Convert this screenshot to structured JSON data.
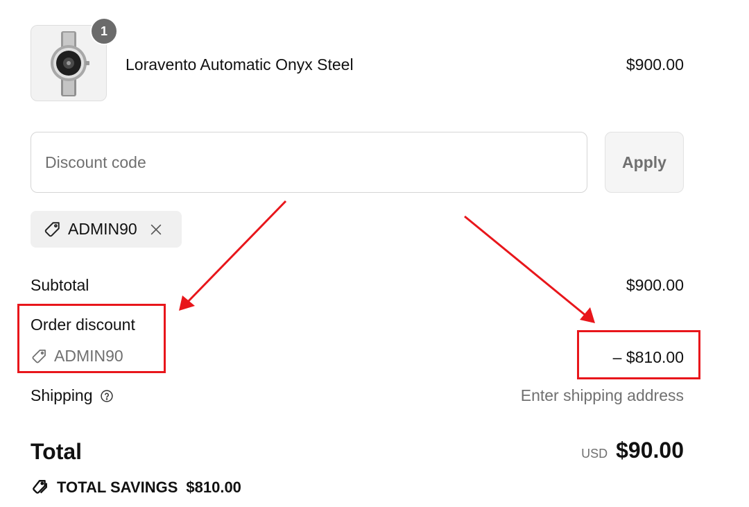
{
  "product": {
    "quantity": "1",
    "name": "Loravento Automatic Onyx Steel",
    "price": "$900.00"
  },
  "discount": {
    "placeholder": "Discount code",
    "apply_label": "Apply",
    "applied_code": "ADMIN90"
  },
  "summary": {
    "subtotal_label": "Subtotal",
    "subtotal_value": "$900.00",
    "discount_label": "Order discount",
    "discount_code": "ADMIN90",
    "discount_value": "– $810.00",
    "shipping_label": "Shipping",
    "shipping_value": "Enter shipping address",
    "total_label": "Total",
    "total_currency": "USD",
    "total_value": "$90.00",
    "savings_label": "TOTAL SAVINGS",
    "savings_value": "$810.00"
  },
  "colors": {
    "annotation_red": "#e8161b",
    "muted_text": "#707070",
    "chip_background": "#f0f0f0",
    "badge_background": "#6b6b6b"
  },
  "icons": {
    "code_chip": "tag-icon",
    "remove": "close-icon",
    "discount_code": "tag-icon",
    "shipping_help": "help-circle-icon",
    "savings": "tags-icon"
  }
}
